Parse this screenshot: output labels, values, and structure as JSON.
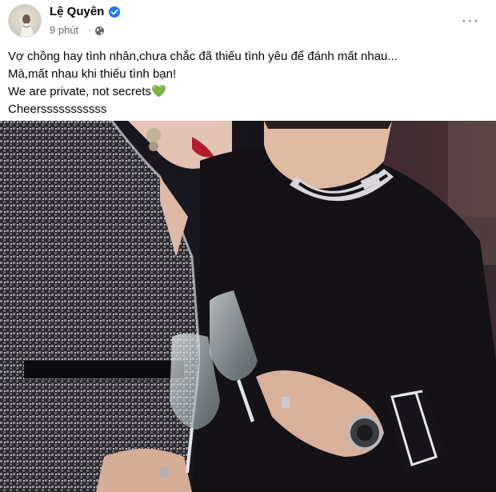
{
  "post": {
    "author": "Lệ Quyên",
    "timestamp": "9 phút",
    "separator": "·",
    "privacy_icon": "globe-icon",
    "verified_icon": "verified-badge-icon",
    "more_icon": "more-options-icon",
    "more_label": "···",
    "lines": [
      "Vợ chồng hay tình nhân,chưa chắc đã thiếu tình yêu để đánh mất nhau...",
      "Mà,mất nhau khi thiếu tình bạn!",
      "We are private, not secrets",
      "Cheersssssssssss"
    ],
    "emoji": "💚",
    "emoji_name": "green-heart-icon"
  },
  "colors": {
    "accent": "#1877f2",
    "text": "#050505",
    "muted": "#65676b"
  }
}
